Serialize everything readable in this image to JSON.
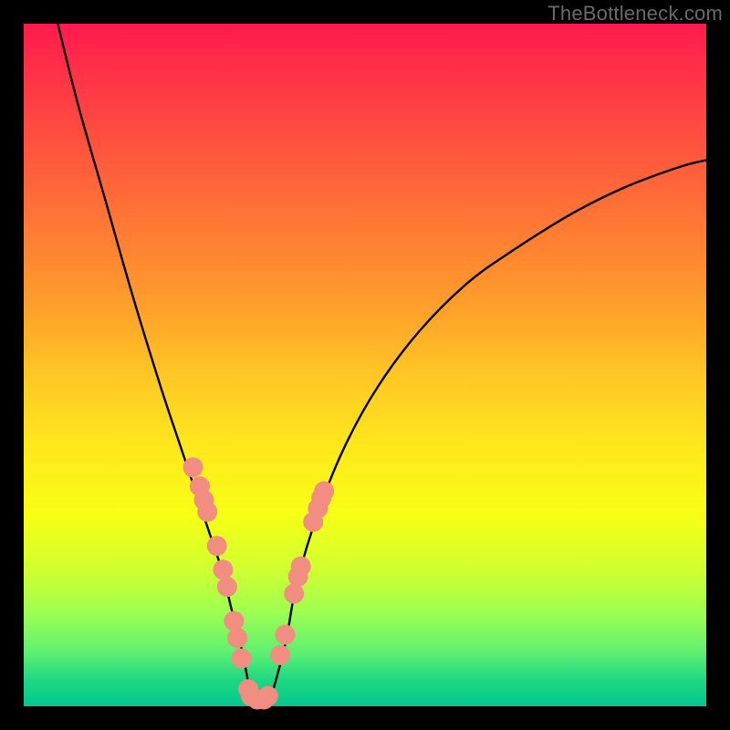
{
  "watermark": "TheBottleneck.com",
  "chart_data": {
    "type": "line",
    "title": "",
    "xlabel": "",
    "ylabel": "",
    "xlim": [
      0,
      100
    ],
    "ylim": [
      0,
      100
    ],
    "grid": false,
    "legend": false,
    "background_gradient": {
      "direction": "vertical",
      "stops": [
        {
          "pos": 0,
          "color": "#ff1a4d"
        },
        {
          "pos": 50,
          "color": "#ffc824"
        },
        {
          "pos": 75,
          "color": "#f7ff14"
        },
        {
          "pos": 100,
          "color": "#00c890"
        }
      ]
    },
    "series": [
      {
        "name": "bottleneck-curve",
        "color": "#000000",
        "x": [
          5,
          8,
          12,
          16,
          20,
          23,
          25,
          27,
          29,
          30.5,
          32,
          33,
          33.5,
          34,
          35,
          36,
          37,
          38.5,
          40,
          43,
          47,
          52,
          58,
          65,
          72,
          80,
          88,
          96,
          100
        ],
        "values": [
          100,
          88,
          74,
          60,
          47,
          38,
          32,
          26,
          20,
          14,
          8,
          3,
          1,
          0,
          0,
          1,
          4,
          10,
          18,
          28,
          38,
          47,
          55,
          62,
          67,
          72,
          76,
          79,
          80
        ]
      }
    ],
    "markers": {
      "name": "highlight-dots",
      "color": "#f28d82",
      "radius_px": 11,
      "points": [
        {
          "x": 24.8,
          "y": 35.0
        },
        {
          "x": 25.8,
          "y": 32.2
        },
        {
          "x": 26.4,
          "y": 30.2
        },
        {
          "x": 26.9,
          "y": 28.5
        },
        {
          "x": 28.3,
          "y": 23.5
        },
        {
          "x": 29.2,
          "y": 20.0
        },
        {
          "x": 29.8,
          "y": 17.5
        },
        {
          "x": 30.8,
          "y": 12.5
        },
        {
          "x": 31.3,
          "y": 10.0
        },
        {
          "x": 31.9,
          "y": 7.0
        },
        {
          "x": 32.9,
          "y": 2.5
        },
        {
          "x": 33.3,
          "y": 1.5
        },
        {
          "x": 34.2,
          "y": 1.0
        },
        {
          "x": 35.2,
          "y": 1.0
        },
        {
          "x": 35.8,
          "y": 1.5
        },
        {
          "x": 37.6,
          "y": 7.5
        },
        {
          "x": 38.3,
          "y": 10.5
        },
        {
          "x": 39.6,
          "y": 16.5
        },
        {
          "x": 40.2,
          "y": 19.0
        },
        {
          "x": 40.6,
          "y": 20.5
        },
        {
          "x": 42.4,
          "y": 27.0
        },
        {
          "x": 43.1,
          "y": 29.0
        },
        {
          "x": 43.6,
          "y": 30.5
        },
        {
          "x": 44.0,
          "y": 31.5
        }
      ]
    }
  }
}
